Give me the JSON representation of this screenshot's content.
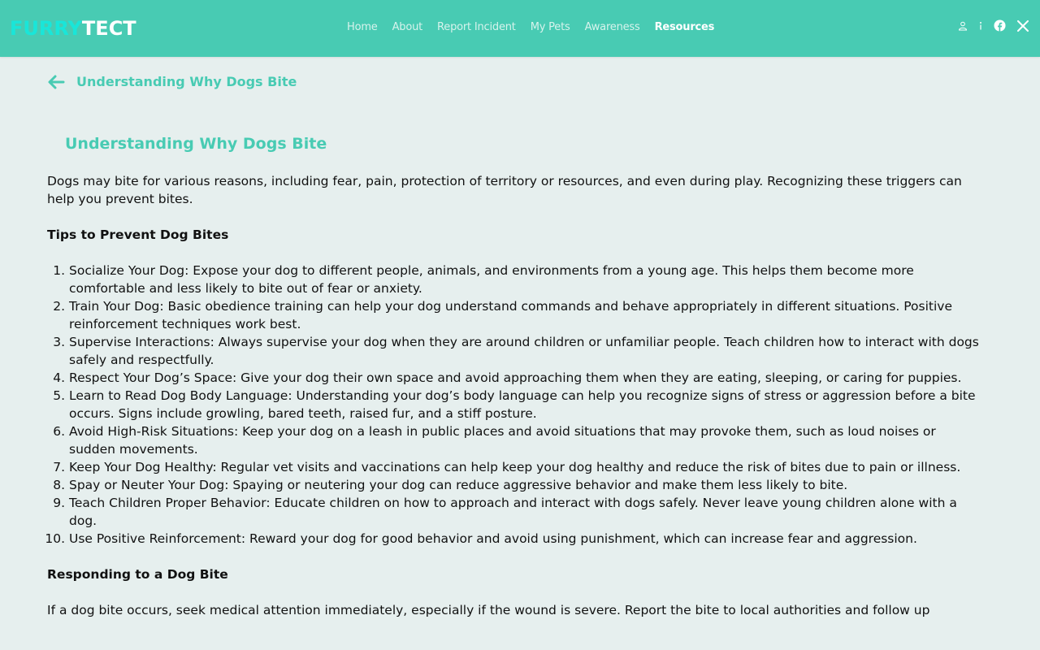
{
  "brand": {
    "logo_part1": "FURRY",
    "logo_part2": "TECT",
    "color_primary": "#48cbb3",
    "color_logo_accent": "#19e6d9"
  },
  "nav": {
    "items": [
      {
        "label": "Home"
      },
      {
        "label": "About"
      },
      {
        "label": "Report Incident"
      },
      {
        "label": "My Pets"
      },
      {
        "label": "Awareness"
      },
      {
        "label": "Resources",
        "active": true
      }
    ]
  },
  "header_icons": [
    "user-icon",
    "info-icon",
    "facebook-icon",
    "x-icon"
  ],
  "page": {
    "back_title": "Understanding Why Dogs Bite",
    "article_title": "Understanding Why Dogs Bite",
    "intro": "Dogs may bite for various reasons, including fear, pain, protection of territory or resources, and even during play. Recognizing these triggers can help you prevent bites.",
    "tips_heading": "Tips to Prevent Dog Bites",
    "tips": [
      "Socialize Your Dog: Expose your dog to different people, animals, and environments from a young age. This helps them become more comfortable and less likely to bite out of fear or anxiety.",
      "Train Your Dog: Basic obedience training can help your dog understand commands and behave appropriately in different situations. Positive reinforcement techniques work best.",
      "Supervise Interactions: Always supervise your dog when they are around children or unfamiliar people. Teach children how to interact with dogs safely and respectfully.",
      "Respect Your Dog’s Space: Give your dog their own space and avoid approaching them when they are eating, sleeping, or caring for puppies.",
      "Learn to Read Dog Body Language: Understanding your dog’s body language can help you recognize signs of stress or aggression before a bite occurs. Signs include growling, bared teeth, raised fur, and a stiff posture.",
      "Avoid High-Risk Situations: Keep your dog on a leash in public places and avoid situations that may provoke them, such as loud noises or sudden movements.",
      "Keep Your Dog Healthy: Regular vet visits and vaccinations can help keep your dog healthy and reduce the risk of bites due to pain or illness.",
      "Spay or Neuter Your Dog: Spaying or neutering your dog can reduce aggressive behavior and make them less likely to bite.",
      "Teach Children Proper Behavior: Educate children on how to approach and interact with dogs safely. Never leave young children alone with a dog.",
      "Use Positive Reinforcement: Reward your dog for good behavior and avoid using punishment, which can increase fear and aggression."
    ],
    "response_heading": "Responding to a Dog Bite",
    "response_text": "If a dog bite occurs, seek medical attention immediately, especially if the wound is severe. Report the bite to local authorities and follow up"
  }
}
